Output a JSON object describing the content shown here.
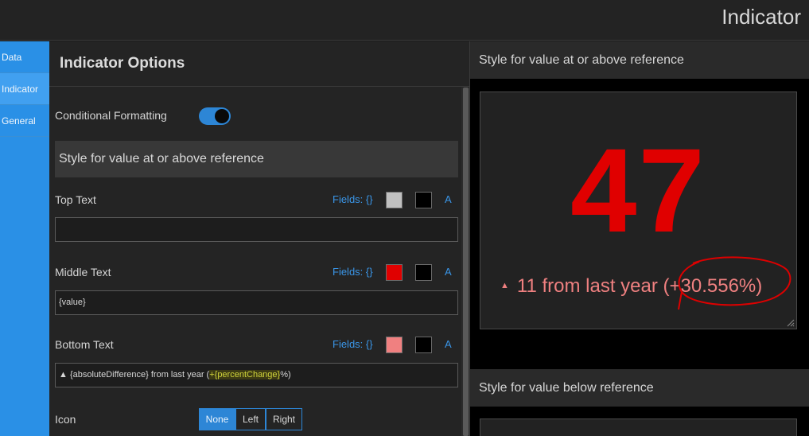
{
  "header": {
    "title": "Indicator"
  },
  "sidebar": {
    "items": [
      {
        "label": "Data"
      },
      {
        "label": "Indicator"
      },
      {
        "label": "General"
      }
    ]
  },
  "options": {
    "title": "Indicator Options",
    "conditional_formatting": {
      "label": "Conditional Formatting",
      "enabled": true
    },
    "section_title": "Style for value at or above reference",
    "top_text": {
      "label": "Top Text",
      "fields_label": "Fields: {}",
      "text_color": "#c0c0c0",
      "bg_color": "#000000",
      "font_label": "A",
      "value": ""
    },
    "middle_text": {
      "label": "Middle Text",
      "fields_label": "Fields: {}",
      "text_color": "#e00000",
      "bg_color": "#000000",
      "font_label": "A",
      "value": "{value}"
    },
    "bottom_text": {
      "label": "Bottom Text",
      "fields_label": "Fields: {}",
      "text_color": "#f08080",
      "bg_color": "#000000",
      "font_label": "A",
      "value_prefix": "▲ {absoluteDifference} from last year (",
      "value_highlight": "+{percentChange}",
      "value_suffix": "%)"
    },
    "icon": {
      "label": "Icon",
      "options": [
        "None",
        "Left",
        "Right"
      ],
      "selected": "None"
    }
  },
  "preview": {
    "above_title": "Style for value at or above reference",
    "big_value": "47",
    "bottom_icon": "▲",
    "bottom_text": "11 from last year (+30.556%)",
    "below_title": "Style for value below reference"
  }
}
